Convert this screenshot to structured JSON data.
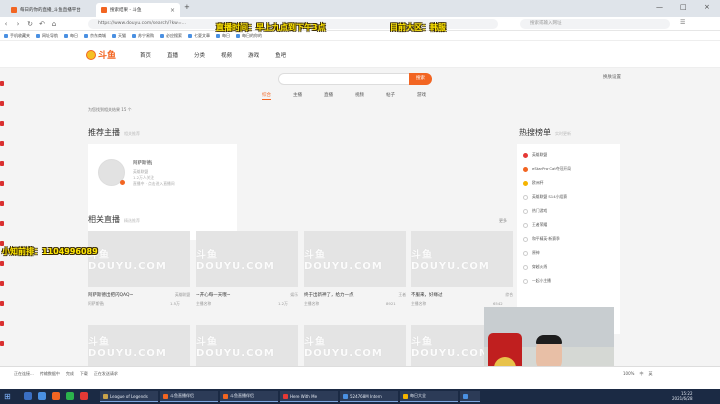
{
  "browser": {
    "tabs": [
      {
        "label": "每日的你的直播_斗鱼直播平台"
      },
      {
        "label": "搜索结果 - 斗鱼"
      }
    ],
    "url": "https://www.douyu.com/search/?kw=...",
    "search_placeholder": "搜索或输入网址",
    "bookmarks": [
      "手机收藏夹",
      "网址导航",
      "每日",
      "京东商城",
      "天猫",
      "苏宁易购",
      "必应搜索",
      "七夏文章",
      "每日",
      "每日的你的"
    ]
  },
  "site": {
    "logo_text": "斗鱼",
    "nav": [
      "首页",
      "直播",
      "分类",
      "视频",
      "游戏",
      "鱼吧"
    ],
    "search_button": "搜索",
    "change_skin": "换肤设置",
    "category_tabs": [
      "综合",
      "主播",
      "直播",
      "视频",
      "帖子",
      "游戏"
    ],
    "result_count": "为您找到相关结果 15 个",
    "recommend_title": "推荐主播",
    "recommend_sub": "相关推荐",
    "anchor": {
      "name": "阿萨斯德j",
      "lines": [
        "英雄联盟",
        "1.2万人关注",
        "直播中 · 点击进入直播间"
      ]
    },
    "related_title": "相关直播",
    "related_sub": "精选推荐",
    "more_label": "更多",
    "watermark_text": "斗鱼 DOUYU.COM",
    "streams": [
      {
        "title": "阿萨斯德出把闪QAQ~",
        "category": "英雄联盟",
        "author": "阿萨斯德j",
        "heat": "1.5万"
      },
      {
        "title": "~开心每一天哦~",
        "category": "娱乐",
        "author": "主播名称",
        "heat": "1.2万"
      },
      {
        "title": "终于出新神了，给力一点",
        "category": "王者",
        "author": "主播名称",
        "heat": "8921"
      },
      {
        "title": "不服来，好缘过",
        "category": "综合",
        "author": "主播名称",
        "heat": "6542"
      }
    ],
    "hot_title": "热搜榜单",
    "hot_sub": "实时更新",
    "hot_list": [
      "英雄联盟",
      "eStarPro·Cat夺冠开局",
      "欧洲杯",
      "英雄联盟 S14小组赛",
      "热门游戏",
      "王者荣耀",
      "和平精英·新赛季",
      "原神",
      "穿越火线",
      "一起小主播"
    ],
    "hot_colors": [
      "#e53935",
      "#f26522",
      "#f5b400",
      "#cccccc",
      "#cccccc",
      "#cccccc",
      "#cccccc",
      "#cccccc",
      "#cccccc",
      "#cccccc"
    ]
  },
  "overlays": {
    "schedule": "直播时间：早上九点到下午3点",
    "region": "目前大区：韩服",
    "hotkey": "小知前排：1104996089"
  },
  "statusbar": {
    "items": [
      "正在连接...",
      "传输数据中",
      "完成",
      "下载",
      "正在发送请求"
    ],
    "right": [
      "100%",
      "中",
      "英"
    ]
  },
  "taskbar": {
    "tasks": [
      {
        "label": "League of Legends",
        "color": "#c8a24a"
      },
      {
        "label": "斗鱼直播伴侣",
        "color": "#f26522"
      },
      {
        "label": "斗鱼直播伴侣",
        "color": "#f26522"
      },
      {
        "label": "Here With Me",
        "color": "#e53935"
      },
      {
        "label": "524768M Intern",
        "color": "#4a90e2"
      },
      {
        "label": "每日大全",
        "color": "#f5b400"
      },
      {
        "label": "",
        "color": "#4a90e2"
      }
    ],
    "time": "15:22",
    "date": "2021/6/28"
  }
}
